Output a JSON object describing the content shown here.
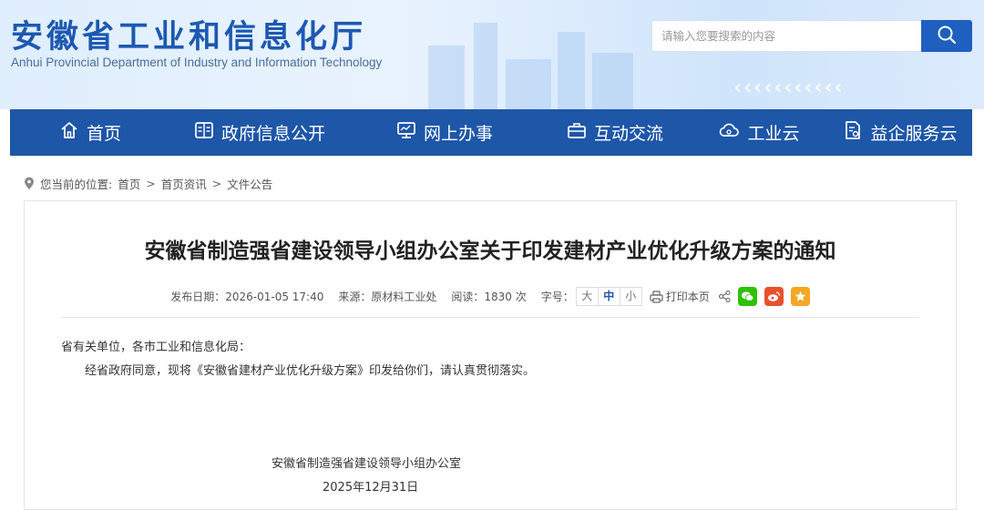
{
  "header": {
    "logo_cn": "安徽省工业和信息化厅",
    "logo_en": "Anhui Provincial Department of Industry and Information Technology",
    "search_placeholder": "请输入您要搜索的内容"
  },
  "nav": {
    "items": [
      {
        "label": "首页",
        "icon": "home-icon"
      },
      {
        "label": "政府信息公开",
        "icon": "document-grid-icon"
      },
      {
        "label": "网上办事",
        "icon": "monitor-icon"
      },
      {
        "label": "互动交流",
        "icon": "briefcase-icon"
      },
      {
        "label": "工业云",
        "icon": "cloud-icon"
      },
      {
        "label": "益企服务云",
        "icon": "document-gear-icon"
      }
    ]
  },
  "breadcrumb": {
    "prefix": "您当前的位置:",
    "items": [
      "首页",
      "首页资讯",
      "文件公告"
    ]
  },
  "article": {
    "title": "安徽省制造强省建设领导小组办公室关于印发建材产业优化升级方案的通知",
    "meta": {
      "date": "发布日期：2026-01-05 17:40",
      "source": "来源：原材料工业处",
      "reads": "阅读：1830 次",
      "font_size_label": "字号：",
      "font_sizes": [
        "大",
        "中",
        "小"
      ],
      "font_size_active": "中",
      "print_label": "打印本页"
    },
    "salutation": "省有关单位，各市工业和信息化局：",
    "paragraph": "经省政府同意，现将《安徽省建材产业优化升级方案》印发给你们，请认真贯彻落实。",
    "signature": "安徽省制造强省建设领导小组办公室",
    "sign_date": "2025年12月31日"
  },
  "colors": {
    "nav_bg": "#1e56a8",
    "logo_blue": "#1d58b2",
    "search_button": "#1f5fbf",
    "wechat": "#2dc100",
    "weibo": "#e6522c",
    "favorite": "#f5a623"
  }
}
